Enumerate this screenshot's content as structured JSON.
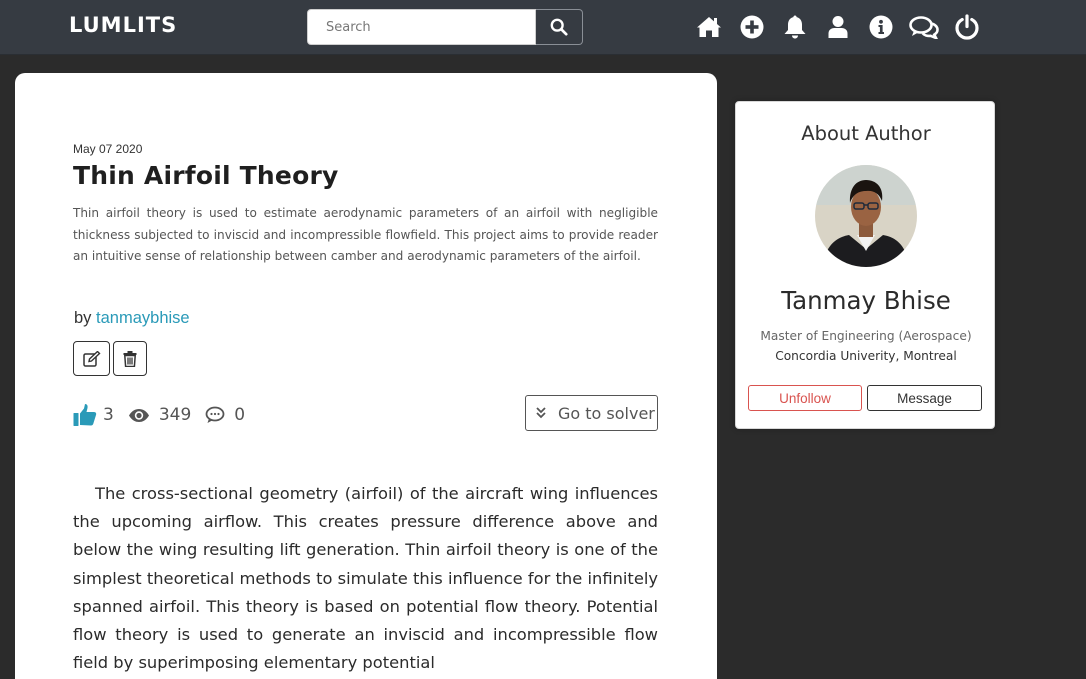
{
  "navbar": {
    "brand": "LUMLITS",
    "search_placeholder": "Search",
    "search_value": "",
    "icons": [
      "home-icon",
      "add-circle-icon",
      "bell-icon",
      "user-icon",
      "info-icon",
      "chat-icon",
      "power-icon"
    ]
  },
  "post": {
    "date": "May 07 2020",
    "title": "Thin Airfoil Theory",
    "abstract": "Thin airfoil theory is used to estimate aerodynamic parameters of an airfoil with negligible thickness subjected to inviscid and incompressible flowfield. This project aims to provide reader an intuitive sense of relationship between camber and aerodynamic parameters of the airfoil.",
    "by_label": "by",
    "author_link": "tanmaybhise",
    "likes": "3",
    "views": "349",
    "comments": "0",
    "solver_label": "Go to solver",
    "body": "The cross-sectional geometry (airfoil) of the aircraft wing influences the upcoming airflow. This creates pressure difference above and below the wing resulting lift generation. Thin airfoil theory is one of the simplest theoretical methods to simulate this influence for the infinitely spanned airfoil. This theory is based on potential flow theory. Potential flow theory is used to generate an inviscid and incompressible flow field by superimposing elementary potential"
  },
  "author": {
    "heading": "About Author",
    "name": "Tanmay Bhise",
    "role": "Master of Engineering (Aerospace)",
    "university": "Concordia Univerity, Montreal",
    "unfollow_label": "Unfollow",
    "message_label": "Message"
  },
  "colors": {
    "navbar_bg": "#363b42",
    "page_bg": "#2b2b2b",
    "link": "#2a9ab8",
    "like_icon": "#2a9ab8",
    "unfollow": "#d9534f"
  }
}
